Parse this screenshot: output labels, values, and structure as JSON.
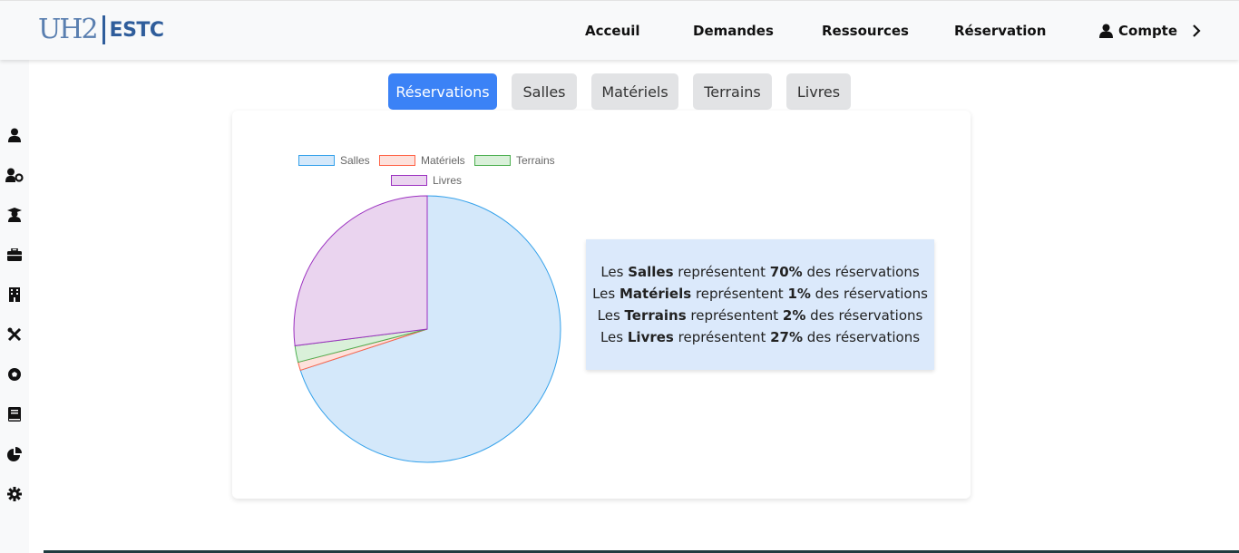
{
  "header": {
    "logo_mark": "UH2",
    "logo_text": "ESTC",
    "nav": [
      {
        "label": "Acceuil"
      },
      {
        "label": "Demandes"
      },
      {
        "label": "Ressources"
      },
      {
        "label": "Réservation"
      }
    ],
    "account": {
      "label": "Compte",
      "icon": "user-icon",
      "chevron": "›"
    }
  },
  "sidebar": {
    "icons": [
      "user-icon",
      "user-gear-icon",
      "graduate-icon",
      "briefcase-icon",
      "building-icon",
      "tools-icon",
      "soccer-ball-icon",
      "book-icon",
      "pie-chart-icon",
      "gear-icon"
    ]
  },
  "tabs": [
    {
      "label": "Réservations",
      "active": true
    },
    {
      "label": "Salles",
      "active": false
    },
    {
      "label": "Matériels",
      "active": false
    },
    {
      "label": "Terrains",
      "active": false
    },
    {
      "label": "Livres",
      "active": false
    }
  ],
  "chart_data": {
    "type": "pie",
    "categories": [
      "Salles",
      "Matériels",
      "Terrains",
      "Livres"
    ],
    "values": [
      70,
      1,
      2,
      27
    ],
    "colors": {
      "fill": [
        "#d4e8fa",
        "#fde1dc",
        "#d9f0d9",
        "#ead4ef"
      ],
      "stroke": [
        "#36a2eb",
        "#ff6347",
        "#4caf50",
        "#9b30c0"
      ]
    },
    "legend_position": "top"
  },
  "summary": [
    {
      "prefix": "Les ",
      "name": "Salles",
      "middle": " représentent ",
      "percent": "70%",
      "suffix": " des réservations"
    },
    {
      "prefix": "Les ",
      "name": "Matériels",
      "middle": " représentent ",
      "percent": "1%",
      "suffix": " des réservations"
    },
    {
      "prefix": "Les ",
      "name": "Terrains",
      "middle": " représentent ",
      "percent": "2%",
      "suffix": " des réservations"
    },
    {
      "prefix": "Les ",
      "name": "Livres",
      "middle": " représentent ",
      "percent": "27%",
      "suffix": " des réservations"
    }
  ]
}
